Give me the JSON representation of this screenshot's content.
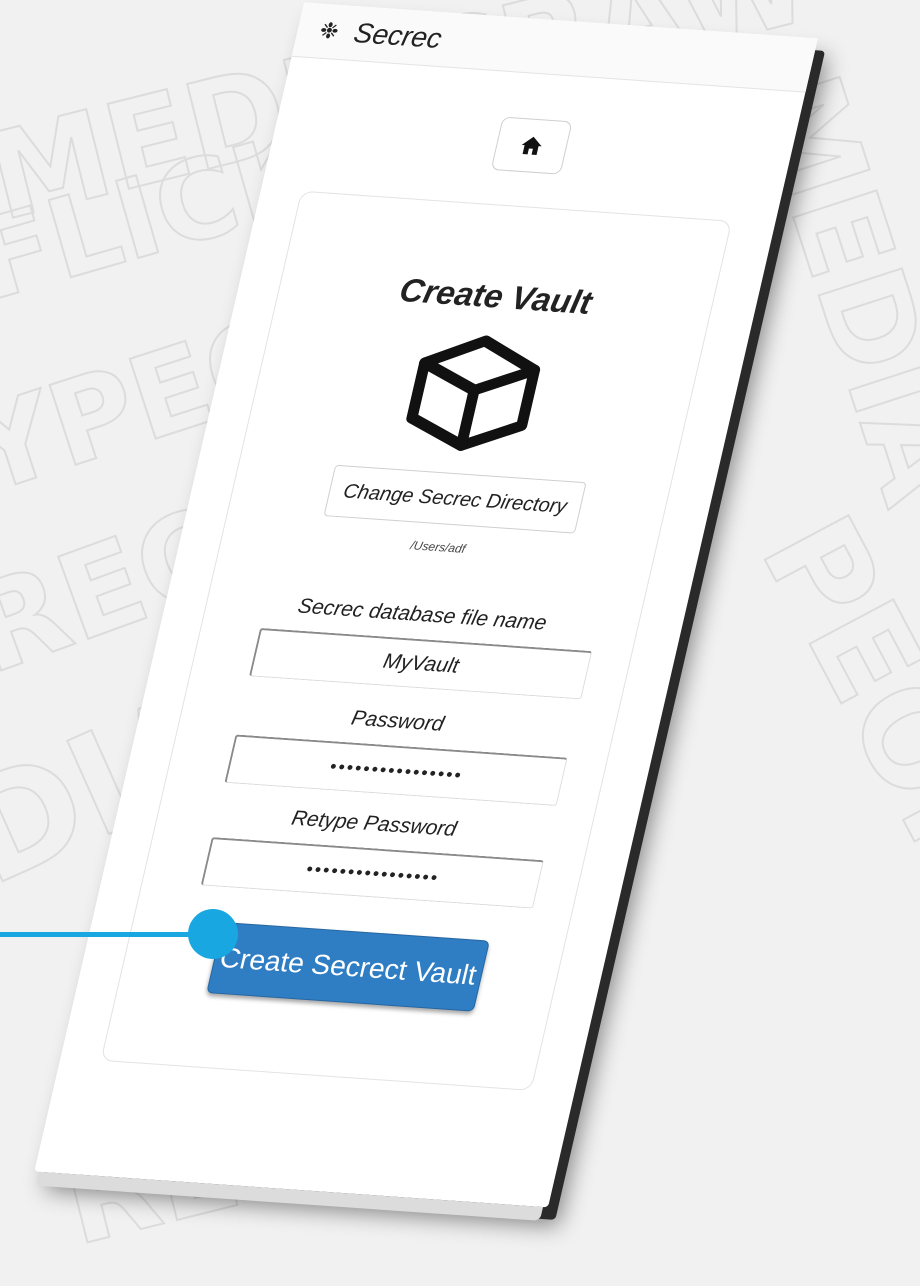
{
  "app": {
    "title": "Secrec",
    "logo_icon": "tree-logo-icon"
  },
  "nav": {
    "home_icon": "home-icon"
  },
  "card": {
    "title": "Create Vault",
    "icon": "cube-icon",
    "change_dir_label": "Change Secrec Directory",
    "dir_path": "/Users/adf"
  },
  "form": {
    "filename_label": "Secrec database file name",
    "filename_value": "MyVault",
    "password_label": "Password",
    "password_value": "••••••••••••••••",
    "retype_label": "Retype Password",
    "retype_value": "••••••••••••••••",
    "submit_label": "Create Secrect Vault"
  },
  "colors": {
    "primary_button": "#2f7ec4",
    "callout": "#19a7e2"
  }
}
